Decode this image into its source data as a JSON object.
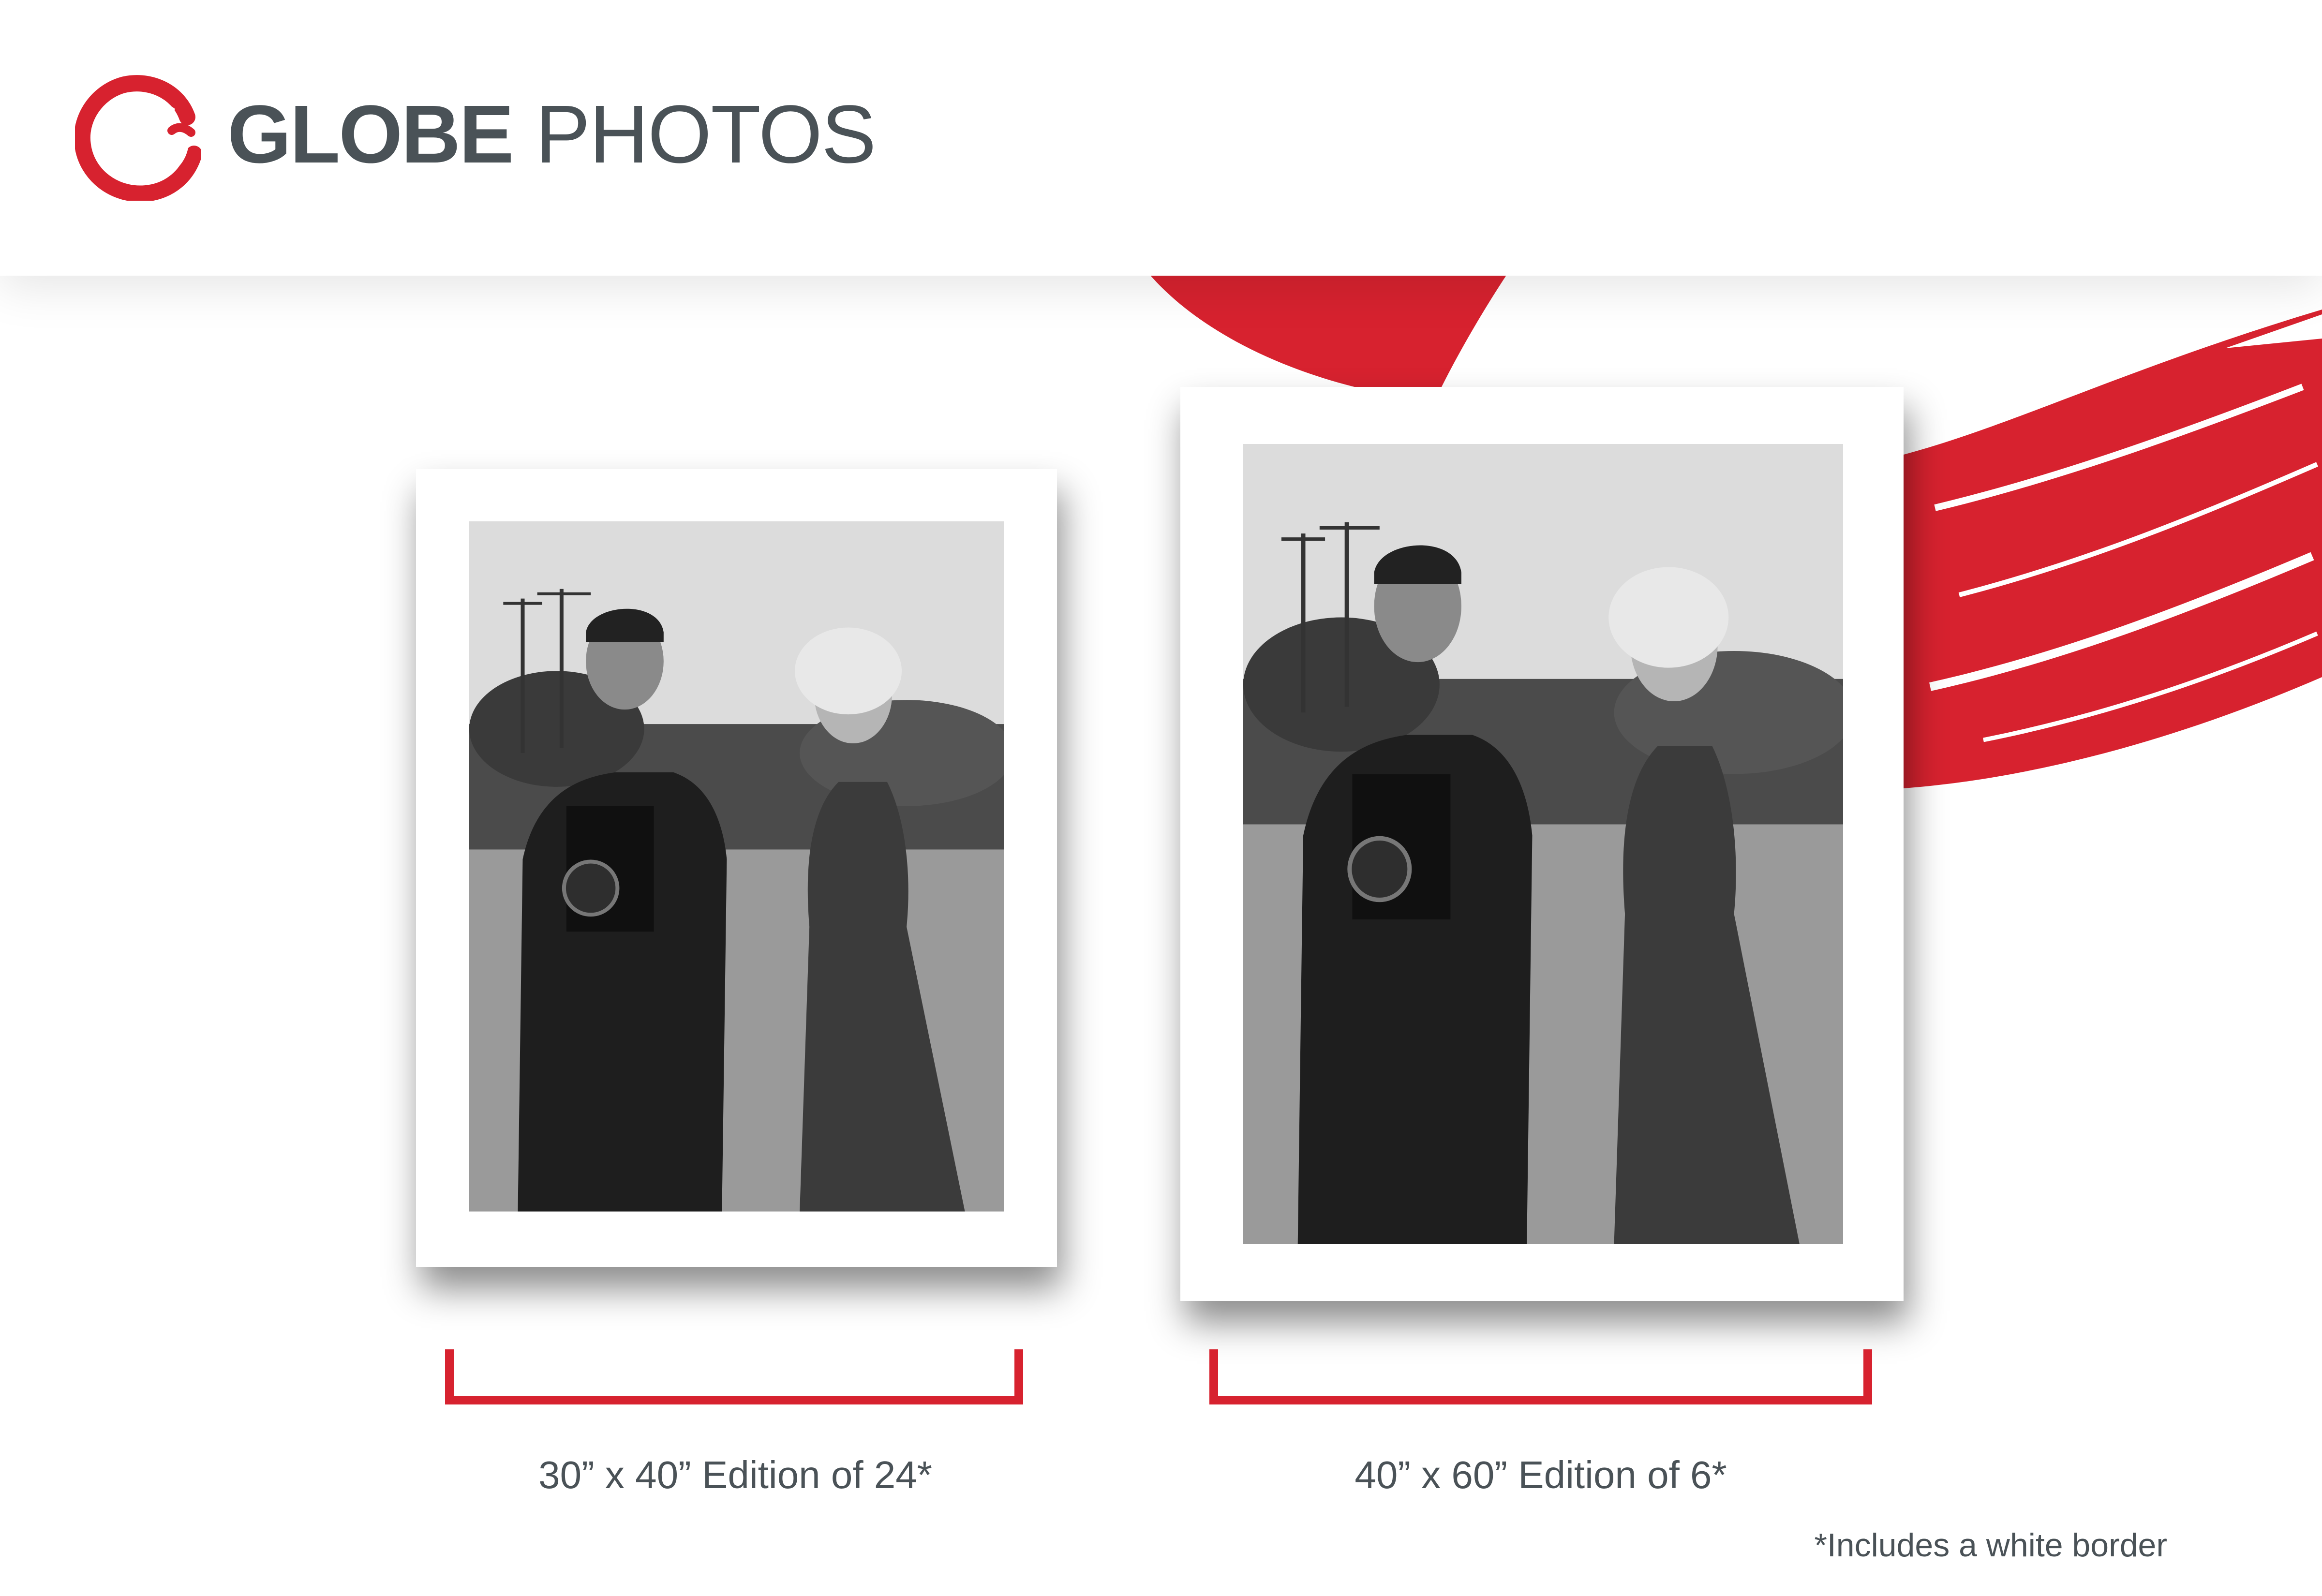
{
  "brand": {
    "bold_text": "GLOBE",
    "light_text": "PHOTOS",
    "accent_color": "#d7222f",
    "text_color": "#4a5257"
  },
  "editions": [
    {
      "label": "30” x 40” Edition of 24*"
    },
    {
      "label": "40” x 60” Edition of 6*"
    }
  ],
  "footnote": "*Includes a white border"
}
